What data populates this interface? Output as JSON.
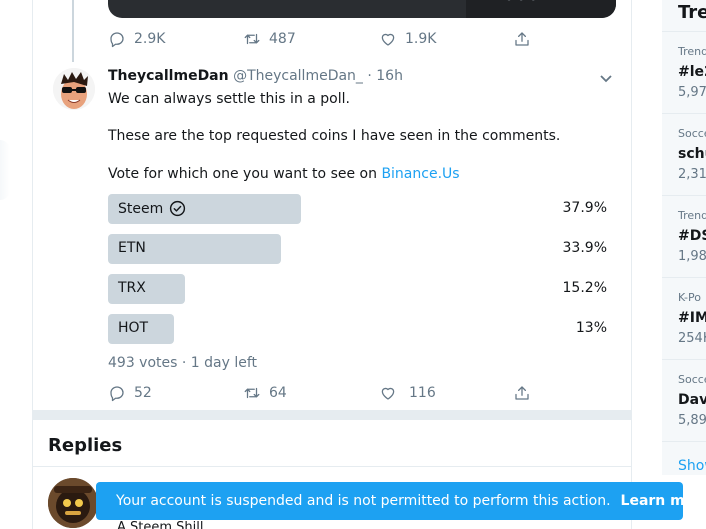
{
  "previous_tweet": {
    "reply_count": "2.9K",
    "retweet_count": "487",
    "like_count": "1.9K"
  },
  "tweet": {
    "display_name": "TheycallmeDan",
    "handle_time": "@TheycallmeDan_ · 16h",
    "line1": "We can always settle this in a poll.",
    "line2": "These are the top requested coins I have seen in the comments.",
    "line3_prefix": "Vote for which one you want to see on ",
    "line3_link": "Binance.Us",
    "poll": {
      "options": [
        {
          "label": "Steem",
          "percent": "37.9%",
          "value": 37.9,
          "selected": true
        },
        {
          "label": "ETN",
          "percent": "33.9%",
          "value": 33.9,
          "selected": false
        },
        {
          "label": "TRX",
          "percent": "15.2%",
          "value": 15.2,
          "selected": false
        },
        {
          "label": "HOT",
          "percent": "13%",
          "value": 13,
          "selected": false
        }
      ],
      "meta": "493 votes · 1 day left"
    },
    "reply_count": "52",
    "retweet_count": "64",
    "like_count": "116"
  },
  "replies": {
    "title": "Replies",
    "first_reply_name": "A Steem Shill"
  },
  "toast": {
    "message": "Your account is suspended and is not permitted to perform this action.",
    "link": "Learn more"
  },
  "sidebar": {
    "title": "Tre",
    "trends": [
      {
        "category": "Trend",
        "name": "#le2",
        "count": "5,97"
      },
      {
        "category": "Socce",
        "name": "schu",
        "count": "2,31"
      },
      {
        "category": "Trend",
        "name": "#DS",
        "count": "1,98"
      },
      {
        "category": "K-Po",
        "name": "#IM",
        "count": "254K"
      },
      {
        "category": "Socce",
        "name": "Dav",
        "count": "5,89"
      }
    ],
    "show_more": "Show"
  },
  "colors": {
    "accent": "#1da1f2",
    "poll_bar": "#ccd6dd",
    "muted_text": "#657786"
  }
}
